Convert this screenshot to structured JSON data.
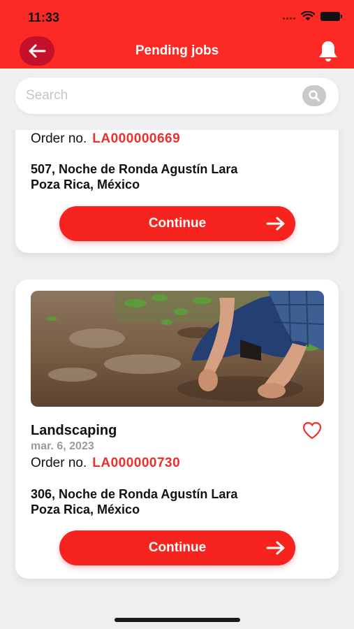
{
  "status": {
    "time": "11:33"
  },
  "header": {
    "title": "Pending jobs"
  },
  "search": {
    "placeholder": "Search"
  },
  "jobs": [
    {
      "order_label": "Order no.",
      "order_number": "LA000000669",
      "address_line1": "507, Noche de Ronda Agustín Lara",
      "address_line2": "Poza Rica, México",
      "button_label": "Continue"
    },
    {
      "title": "Landscaping",
      "date": "mar. 6, 2023",
      "order_label": "Order no.",
      "order_number": "LA000000730",
      "address_line1": "306, Noche de Ronda Agustín Lara",
      "address_line2": "Poza Rica, México",
      "button_label": "Continue",
      "favorite": false
    }
  ],
  "colors": {
    "brand_red": "#fb2a25",
    "button_red": "#f6231f",
    "order_red": "#e8312c",
    "back_button": "#c5102b"
  }
}
